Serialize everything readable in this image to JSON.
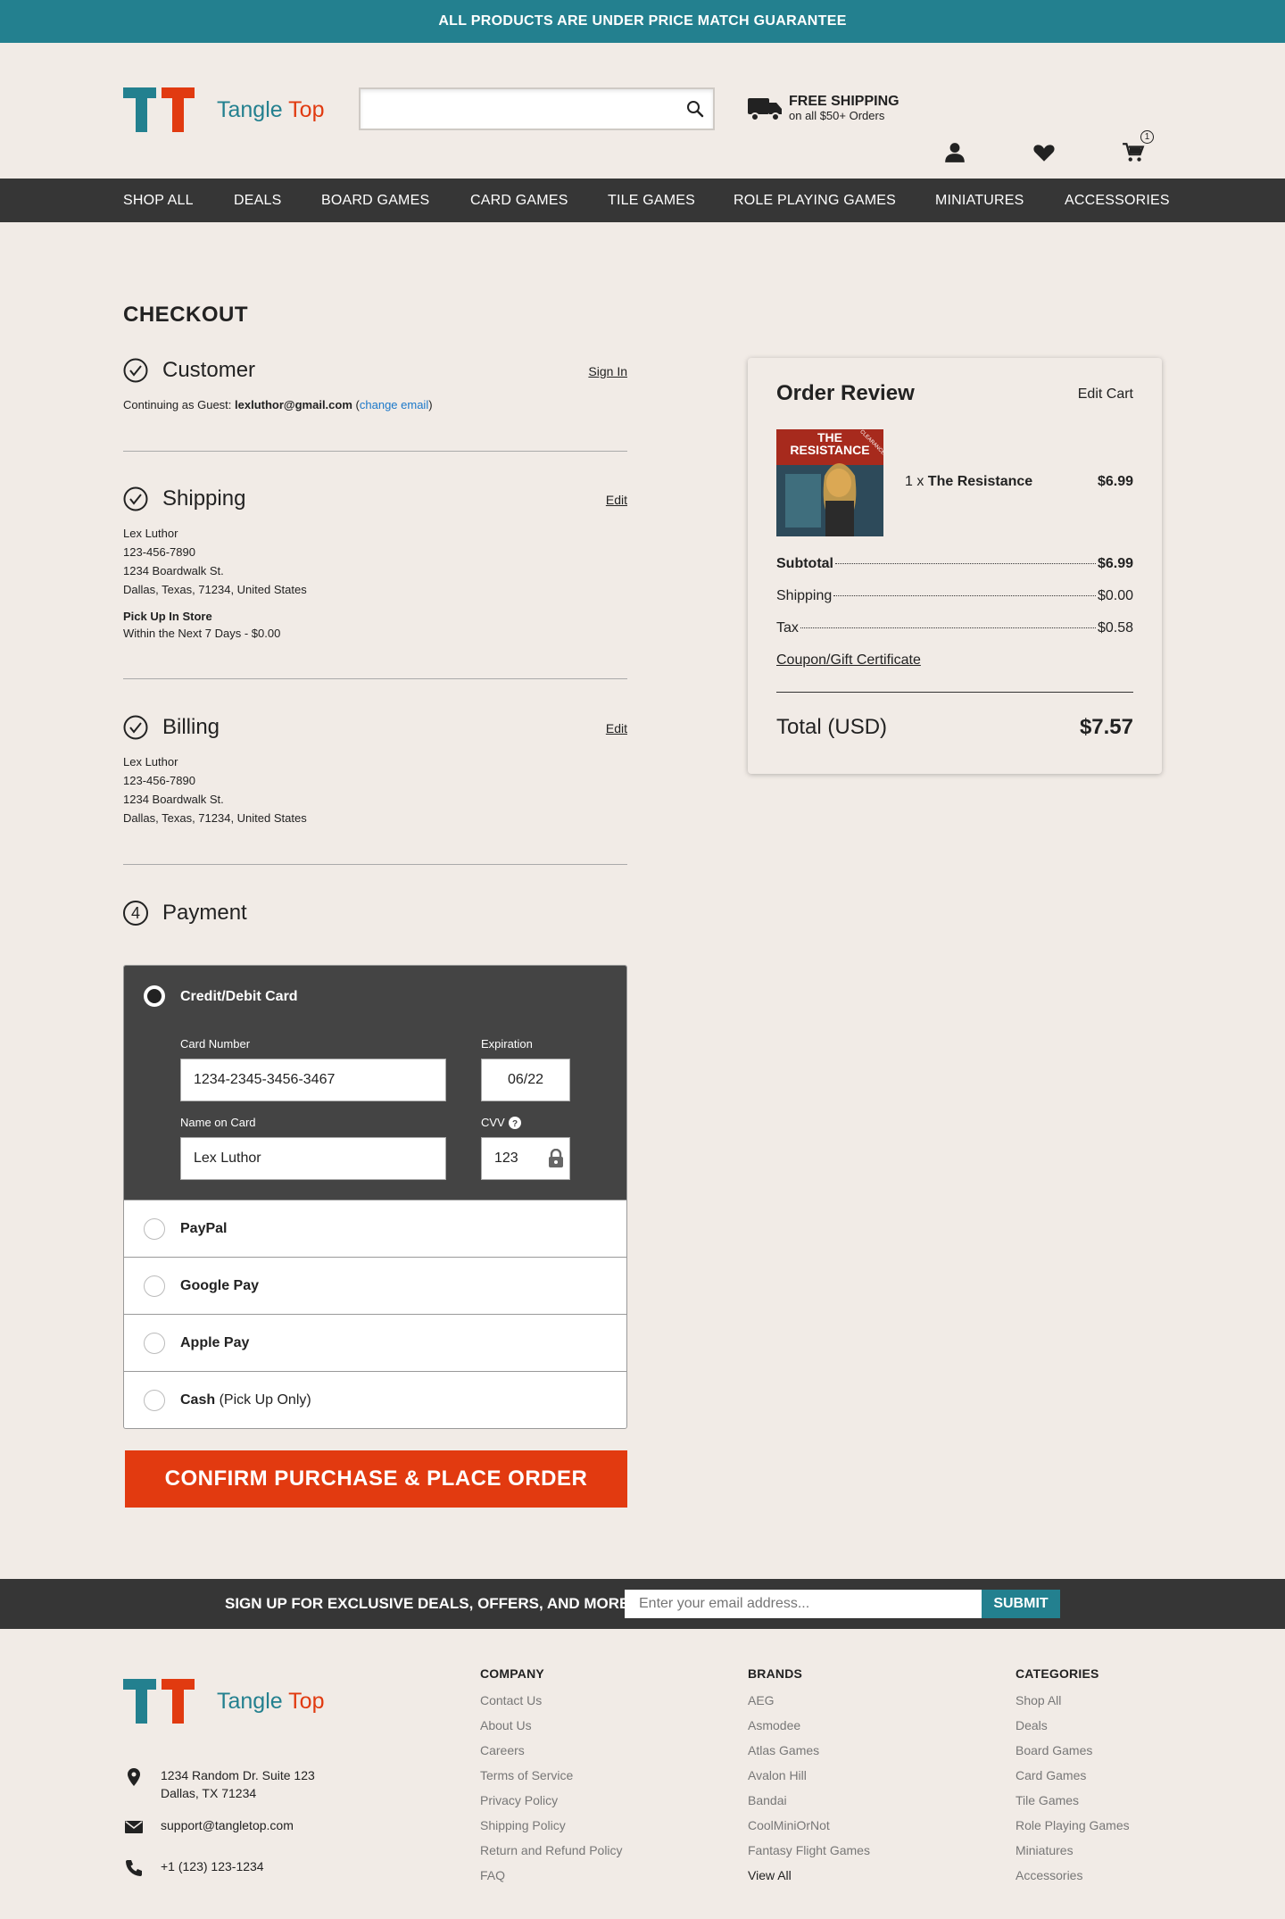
{
  "promo_banner": "ALL PRODUCTS ARE UNDER PRICE MATCH GUARANTEE",
  "brand": {
    "name_part1": "Tangle",
    "name_part2": "Top",
    "color_teal": "#23808f",
    "color_red": "#e13a10"
  },
  "search": {
    "value": "",
    "placeholder": ""
  },
  "shipping_promo": {
    "title": "FREE SHIPPING",
    "subtitle": "on all $50+ Orders"
  },
  "cart_count": "1",
  "nav": [
    "SHOP ALL",
    "DEALS",
    "BOARD GAMES",
    "CARD GAMES",
    "TILE GAMES",
    "ROLE PLAYING GAMES",
    "MINIATURES",
    "ACCESSORIES"
  ],
  "checkout": {
    "title": "CHECKOUT",
    "customer": {
      "title": "Customer",
      "link": "Sign In",
      "guest_prefix": "Continuing as Guest: ",
      "email": "lexluthor@gmail.com",
      "change_open": "(",
      "change_email": "change email",
      "change_close": ")"
    },
    "shipping": {
      "title": "Shipping",
      "link": "Edit",
      "name": "Lex Luthor",
      "phone": "123-456-7890",
      "street": "1234 Boardwalk St.",
      "city": "Dallas, Texas, 71234, United States",
      "method": "Pick Up In Store",
      "method_detail": "Within the Next 7 Days - $0.00"
    },
    "billing": {
      "title": "Billing",
      "link": "Edit",
      "name": "Lex Luthor",
      "phone": "123-456-7890",
      "street": "1234 Boardwalk St.",
      "city": "Dallas, Texas, 71234, United States"
    },
    "payment": {
      "step_number": "4",
      "title": "Payment",
      "card_option": "Credit/Debit Card",
      "card_number_label": "Card Number",
      "card_number": "1234-2345-3456-3467",
      "expiration_label": "Expiration",
      "expiration": "06/22",
      "name_label": "Name on Card",
      "name": "Lex Luthor",
      "cvv_label": "CVV",
      "cvv": "123",
      "options": [
        {
          "label": "PayPal",
          "extra": ""
        },
        {
          "label": "Google Pay",
          "extra": ""
        },
        {
          "label": "Apple Pay",
          "extra": ""
        },
        {
          "label": "Cash",
          "extra": " (Pick Up Only)"
        }
      ]
    },
    "confirm_button": "CONFIRM PURCHASE & PLACE ORDER"
  },
  "order_review": {
    "title": "Order Review",
    "edit_cart": "Edit Cart",
    "item": {
      "qty": "1 x ",
      "name": "The Resistance",
      "price": "$6.99",
      "box_title": "THE RESISTANCE",
      "box_tag": "CLEARANCE"
    },
    "subtotal_label": "Subtotal",
    "subtotal": "$6.99",
    "shipping_label": "Shipping",
    "shipping": "$0.00",
    "tax_label": "Tax",
    "tax": "$0.58",
    "coupon": "Coupon/Gift Certificate",
    "total_label": "Total (USD)",
    "total": "$7.57"
  },
  "newsletter": {
    "text": "SIGN UP FOR EXCLUSIVE DEALS, OFFERS, AND MORE!",
    "placeholder": "Enter your email address...",
    "button": "SUBMIT"
  },
  "footer": {
    "address_line1": "1234 Random Dr. Suite 123",
    "address_line2": "Dallas, TX 71234",
    "email": "support@tangletop.com",
    "phone": "+1 (123) 123-1234",
    "company": {
      "title": "COMPANY",
      "links": [
        "Contact Us",
        "About Us",
        "Careers",
        "Terms of Service",
        "Privacy Policy",
        "Shipping Policy",
        "Return and Refund Policy",
        "FAQ"
      ]
    },
    "brands": {
      "title": "BRANDS",
      "links": [
        "AEG",
        "Asmodee",
        "Atlas Games",
        "Avalon Hill",
        "Bandai",
        "CoolMiniOrNot",
        "Fantasy Flight Games"
      ],
      "view_all": "View All"
    },
    "categories": {
      "title": "CATEGORIES",
      "links": [
        "Shop All",
        "Deals",
        "Board Games",
        "Card Games",
        "Tile Games",
        "Role Playing Games",
        "Miniatures",
        "Accessories"
      ]
    }
  }
}
